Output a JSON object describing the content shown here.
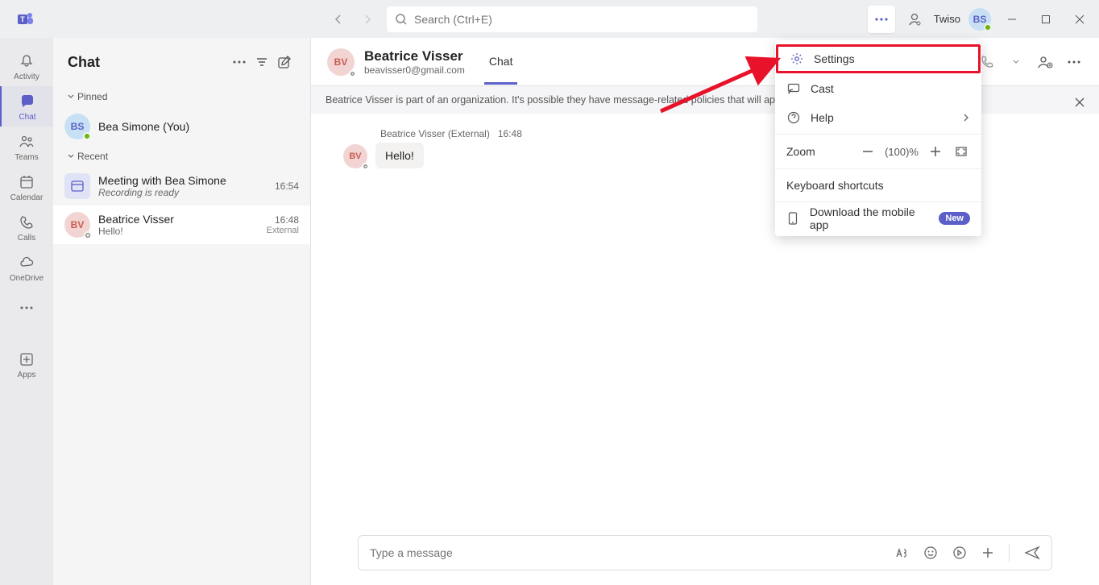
{
  "titlebar": {
    "search_placeholder": "Search (Ctrl+E)",
    "user_label": "Twiso",
    "avatar_initials": "BS"
  },
  "rail": {
    "items": [
      {
        "label": "Activity"
      },
      {
        "label": "Chat"
      },
      {
        "label": "Teams"
      },
      {
        "label": "Calendar"
      },
      {
        "label": "Calls"
      },
      {
        "label": "OneDrive"
      }
    ],
    "apps_label": "Apps"
  },
  "chat_panel": {
    "title": "Chat",
    "pinned_label": "Pinned",
    "recent_label": "Recent",
    "pinned": [
      {
        "initials": "BS",
        "title": "Bea Simone (You)"
      }
    ],
    "recent": [
      {
        "initials": "",
        "title": "Meeting with Bea Simone",
        "subtitle": "Recording is ready",
        "time": "16:54",
        "italic": true,
        "type": "calendar"
      },
      {
        "initials": "BV",
        "title": "Beatrice Visser",
        "subtitle": "Hello!",
        "time": "16:48",
        "ext": "External",
        "selected": true
      }
    ]
  },
  "chat_header": {
    "avatar_initials": "BV",
    "name": "Beatrice Visser",
    "email": "beavisser0@gmail.com",
    "tab_label": "Chat"
  },
  "notice": {
    "text": "Beatrice Visser is part of an organization. It's possible they have message-related policies that will apply to"
  },
  "messages": [
    {
      "sender": "Beatrice Visser (External)",
      "time": "16:48",
      "avatar": "BV",
      "text": "Hello!"
    }
  ],
  "compose": {
    "placeholder": "Type a message"
  },
  "dropdown": {
    "settings": "Settings",
    "cast": "Cast",
    "help": "Help",
    "zoom_label": "Zoom",
    "zoom_value": "(100)%",
    "keyboard": "Keyboard shortcuts",
    "download": "Download the mobile app",
    "new_badge": "New"
  }
}
